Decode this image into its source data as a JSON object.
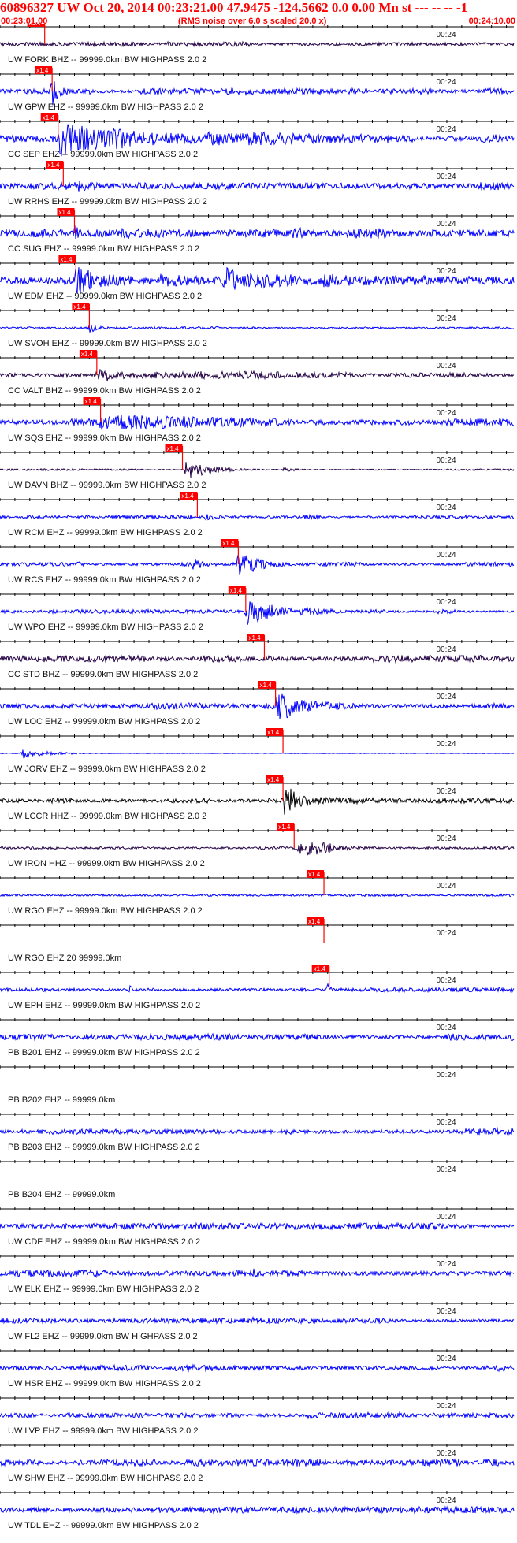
{
  "header": {
    "title": "60896327 UW Oct 20, 2014 00:23:21.00   47.9475 -124.5662  0.0 0.00 Mn st --- -- --   -1",
    "start_time": "00:23:01.00",
    "end_time": "00:24:10.00",
    "subtitle": "(RMS noise over 6.0 s scaled 20.0 x)"
  },
  "colors": {
    "trace_blue": "#0000ff",
    "trace_dark": "#220044",
    "trace_black": "#000000",
    "pick": "#ff0000",
    "axis": "#000000"
  },
  "chart_data": {
    "type": "line",
    "title": "60896327 UW Oct 20, 2014 00:23:21.00   47.9475 -124.5662  0.0 0.00 Mn st --- -- --   -1",
    "subtitle": "(RMS noise over 6.0 s scaled 20.0 x)",
    "x_range": [
      "00:23:01.00",
      "00:24:10.00"
    ],
    "x_tick_label": "00:24",
    "x_tick_label_time": "00:24:00",
    "pick_label": "x1.4",
    "grid": false,
    "traces": [
      {
        "label": "UW FORK BHZ -- 99999.0km BW  HIGHPASS  2.0  2",
        "pick_time": 6.0,
        "color": "dark",
        "amp": 0.12,
        "events": []
      },
      {
        "label": "UW GPW EHZ -- 99999.0km BW  HIGHPASS  2.0  2",
        "pick_time": 7.0,
        "color": "blue",
        "amp": 0.15,
        "events": [
          [
            7.0,
            1.0,
            0.9,
            2.0
          ]
        ]
      },
      {
        "label": "CC SEP EHZ -- 99999.0km BW  HIGHPASS  2.0  2",
        "pick_time": 7.8,
        "color": "blue",
        "amp": 0.2,
        "events": [
          [
            8.0,
            0.95,
            0.9,
            24.0
          ],
          [
            28.0,
            0.55,
            0.4,
            42.0
          ]
        ]
      },
      {
        "label": "UW RRHS EHZ -- 99999.0km BW  HIGHPASS  2.0  2",
        "pick_time": 8.5,
        "color": "blue",
        "amp": 0.2,
        "events": [
          [
            10.0,
            0.45,
            0.3,
            10.0
          ]
        ]
      },
      {
        "label": "CC SUG EHZ -- 99999.0km BW  HIGHPASS  2.0  2",
        "pick_time": 10.0,
        "color": "blue",
        "amp": 0.25,
        "events": [
          [
            10.0,
            0.5,
            0.4,
            50.0
          ]
        ]
      },
      {
        "label": "UW EDM EHZ -- 99999.0km BW  HIGHPASS  2.0  2",
        "pick_time": 10.2,
        "color": "blue",
        "amp": 0.25,
        "events": [
          [
            10.2,
            0.95,
            0.9,
            20.0
          ],
          [
            30.0,
            0.75,
            0.6,
            30.0
          ]
        ]
      },
      {
        "label": "UW SVOH EHZ -- 99999.0km BW  HIGHPASS  2.0  2",
        "pick_time": 12.0,
        "color": "blue",
        "amp": 0.06,
        "events": [
          [
            12.0,
            0.3,
            0.2,
            2.0
          ],
          [
            17.5,
            0.15,
            0.1,
            1.5
          ]
        ]
      },
      {
        "label": "CC VALT BHZ -- 99999.0km BW  HIGHPASS  2.0  2",
        "pick_time": 13.0,
        "color": "dark",
        "amp": 0.12,
        "events": [
          [
            13.0,
            0.4,
            0.3,
            50.0
          ]
        ]
      },
      {
        "label": "UW SQS EHZ -- 99999.0km BW  HIGHPASS  2.0  2",
        "pick_time": 13.5,
        "color": "blue",
        "amp": 0.18,
        "events": [
          [
            13.5,
            0.45,
            0.3,
            50.0
          ]
        ]
      },
      {
        "label": "UW DAVN BHZ -- 99999.0km BW  HIGHPASS  2.0  2",
        "pick_time": 24.5,
        "color": "dark",
        "amp": 0.05,
        "events": [
          [
            25.0,
            0.9,
            0.9,
            6.0
          ],
          [
            38.0,
            0.3,
            0.3,
            3.0
          ]
        ]
      },
      {
        "label": "UW RCM EHZ -- 99999.0km BW  HIGHPASS  2.0  2",
        "pick_time": 26.5,
        "color": "blue",
        "amp": 0.1,
        "events": [
          [
            27.0,
            0.3,
            0.3,
            6.0
          ]
        ]
      },
      {
        "label": "UW RCS EHZ -- 99999.0km BW  HIGHPASS  2.0  2",
        "pick_time": 32.0,
        "color": "blue",
        "amp": 0.1,
        "events": [
          [
            10.5,
            0.35,
            0.3,
            2.0
          ],
          [
            26.0,
            0.35,
            0.3,
            3.0
          ],
          [
            32.0,
            0.8,
            0.6,
            6.0
          ]
        ]
      },
      {
        "label": "UW WPO EHZ -- 99999.0km BW  HIGHPASS  2.0  2",
        "pick_time": 33.0,
        "color": "blue",
        "amp": 0.1,
        "events": [
          [
            33.0,
            0.9,
            0.9,
            10.0
          ]
        ]
      },
      {
        "label": "CC STD BHZ -- 99999.0km BW  HIGHPASS  2.0  2",
        "pick_time": 35.5,
        "color": "dark",
        "amp": 0.18,
        "events": [
          [
            36.0,
            0.3,
            0.3,
            4.0
          ]
        ]
      },
      {
        "label": "UW LOC EHZ -- 99999.0km BW  HIGHPASS  2.0  2",
        "pick_time": 37.0,
        "color": "blue",
        "amp": 0.15,
        "events": [
          [
            37.0,
            0.75,
            0.6,
            14.0
          ]
        ]
      },
      {
        "label": "UW JORV EHZ -- 99999.0km BW  HIGHPASS  2.0  2",
        "pick_time": 38.0,
        "color": "blue",
        "amp": 0.02,
        "events": [
          [
            3.0,
            0.3,
            0.2,
            6.0
          ]
        ]
      },
      {
        "label": "UW LCCR HHZ -- 99999.0km BW  HIGHPASS  2.0  2",
        "pick_time": 38.0,
        "color": "black",
        "amp": 0.12,
        "events": [
          [
            38.0,
            0.7,
            0.5,
            14.0
          ]
        ]
      },
      {
        "label": "UW IRON HHZ -- 99999.0km BW  HIGHPASS  2.0  2",
        "pick_time": 39.5,
        "color": "dark",
        "amp": 0.08,
        "events": [
          [
            40.0,
            0.55,
            0.4,
            10.0
          ]
        ]
      },
      {
        "label": "UW RGO EHZ -- 99999.0km BW  HIGHPASS  2.0  2",
        "pick_time": 43.5,
        "color": "blue",
        "amp": 0.06,
        "events": []
      },
      {
        "label": "UW RGO EHZ 20 99999.0km",
        "pick_time": 43.5,
        "color": "blue",
        "amp": 0.0,
        "events": []
      },
      {
        "label": "UW EPH EHZ -- 99999.0km BW  HIGHPASS  2.0  2",
        "pick_time": 44.2,
        "color": "blue",
        "amp": 0.1,
        "events": [
          [
            17.5,
            0.8,
            0.1,
            0.3
          ],
          [
            44.0,
            0.6,
            0.1,
            1.0
          ]
        ]
      },
      {
        "label": "PB B201 EHZ -- 99999.0km BW  HIGHPASS  2.0  2",
        "pick_time": null,
        "color": "blue",
        "amp": 0.18,
        "events": []
      },
      {
        "label": "PB B202 EHZ -- 99999.0km",
        "pick_time": null,
        "color": "blue",
        "amp": 0.0,
        "events": []
      },
      {
        "label": "PB B203 EHZ -- 99999.0km BW  HIGHPASS  2.0  2",
        "pick_time": null,
        "color": "blue",
        "amp": 0.15,
        "events": []
      },
      {
        "label": "PB B204 EHZ -- 99999.0km",
        "pick_time": null,
        "color": "blue",
        "amp": 0.0,
        "events": []
      },
      {
        "label": "UW CDF EHZ -- 99999.0km BW  HIGHPASS  2.0  2",
        "pick_time": null,
        "color": "blue",
        "amp": 0.15,
        "events": []
      },
      {
        "label": "UW ELK EHZ -- 99999.0km BW  HIGHPASS  2.0  2",
        "pick_time": null,
        "color": "blue",
        "amp": 0.18,
        "events": [
          [
            34.0,
            0.35,
            0.2,
            1.0
          ],
          [
            41.0,
            0.25,
            0.2,
            1.0
          ]
        ]
      },
      {
        "label": "UW FL2 EHZ -- 99999.0km BW  HIGHPASS  2.0  2",
        "pick_time": null,
        "color": "blue",
        "amp": 0.15,
        "events": [
          [
            34.0,
            0.35,
            0.2,
            1.0
          ]
        ]
      },
      {
        "label": "UW HSR EHZ -- 99999.0km BW  HIGHPASS  2.0  2",
        "pick_time": null,
        "color": "blue",
        "amp": 0.15,
        "events": []
      },
      {
        "label": "UW LVP EHZ -- 99999.0km BW  HIGHPASS  2.0  2",
        "pick_time": null,
        "color": "blue",
        "amp": 0.15,
        "events": []
      },
      {
        "label": "UW SHW EHZ -- 99999.0km BW  HIGHPASS  2.0  2",
        "pick_time": null,
        "color": "blue",
        "amp": 0.18,
        "events": []
      },
      {
        "label": "UW TDL EHZ -- 99999.0km BW  HIGHPASS  2.0  2",
        "pick_time": null,
        "color": "blue",
        "amp": 0.15,
        "events": []
      }
    ]
  }
}
